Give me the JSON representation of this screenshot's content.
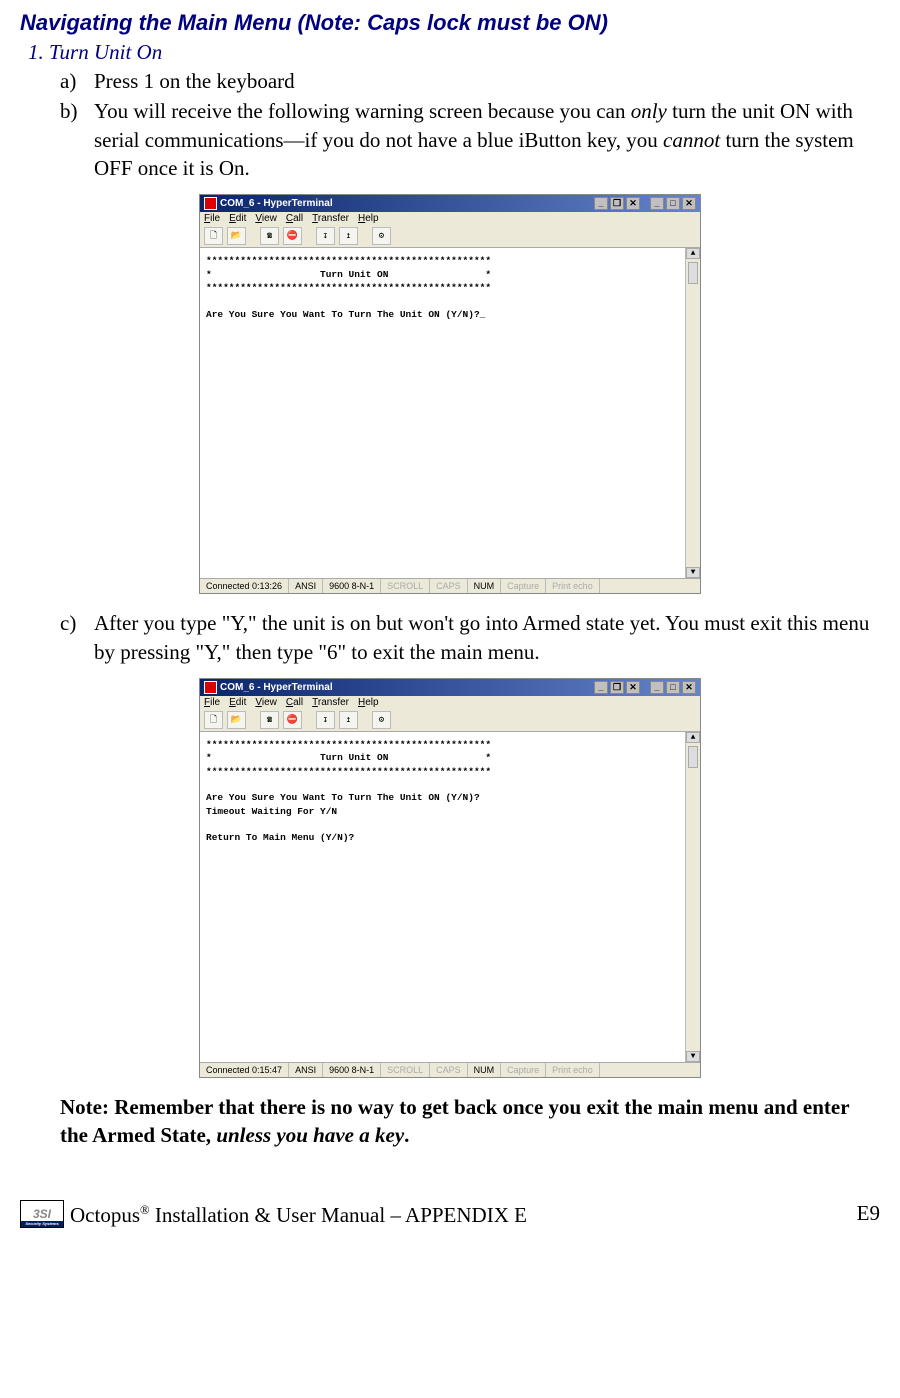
{
  "heading": "Navigating the Main Menu (Note: Caps lock must be ON)",
  "step1": {
    "label": "1.   Turn Unit On",
    "a_label": "a)",
    "a_text_pre": "Press 1 on the keyboard",
    "b_label": "b)",
    "b_text_1": "You will receive the following warning screen because you can ",
    "b_text_only": "only",
    "b_text_2": " turn the unit ON with serial communications—if you do not have a blue iButton key, you ",
    "b_text_cannot": "cannot",
    "b_text_3": " turn the system OFF once it is On.",
    "c_label": "c)",
    "c_text": "After you type \"Y,\" the unit is on but won't go into Armed state yet. You must exit this menu by pressing \"Y,\" then type \"6\" to exit the main menu."
  },
  "terminal1": {
    "title": "COM_6 - HyperTerminal",
    "menu": {
      "file": "File",
      "edit": "Edit",
      "view": "View",
      "call": "Call",
      "transfer": "Transfer",
      "help": "Help"
    },
    "body": "**************************************************\n*                   Turn Unit ON                 *\n**************************************************\n\nAre You Sure You Want To Turn The Unit ON (Y/N)?_",
    "status": {
      "connected": "Connected 0:13:26",
      "term": "ANSI",
      "baud": "9600 8-N-1",
      "scroll": "SCROLL",
      "caps": "CAPS",
      "num": "NUM",
      "capture": "Capture",
      "echo": "Print echo"
    }
  },
  "terminal2": {
    "title": "COM_6 - HyperTerminal",
    "menu": {
      "file": "File",
      "edit": "Edit",
      "view": "View",
      "call": "Call",
      "transfer": "Transfer",
      "help": "Help"
    },
    "body": "**************************************************\n*                   Turn Unit ON                 *\n**************************************************\n\nAre You Sure You Want To Turn The Unit ON (Y/N)?\nTimeout Waiting For Y/N\n\nReturn To Main Menu (Y/N)?",
    "status": {
      "connected": "Connected 0:15:47",
      "term": "ANSI",
      "baud": "9600 8-N-1",
      "scroll": "SCROLL",
      "caps": "CAPS",
      "num": "NUM",
      "capture": "Capture",
      "echo": "Print echo"
    }
  },
  "note": {
    "line1": "Note: Remember that there is no way to get back once you exit the main menu and enter the Armed State, ",
    "unless": "unless you have a key",
    "dot": "."
  },
  "footer": {
    "logo_text": "3SI",
    "logo_bar": "Security Systems",
    "center_pre": "Octopus",
    "center_sup": "®",
    "center_post": " Installation & User Manual – APPENDIX E",
    "page": "E9"
  }
}
